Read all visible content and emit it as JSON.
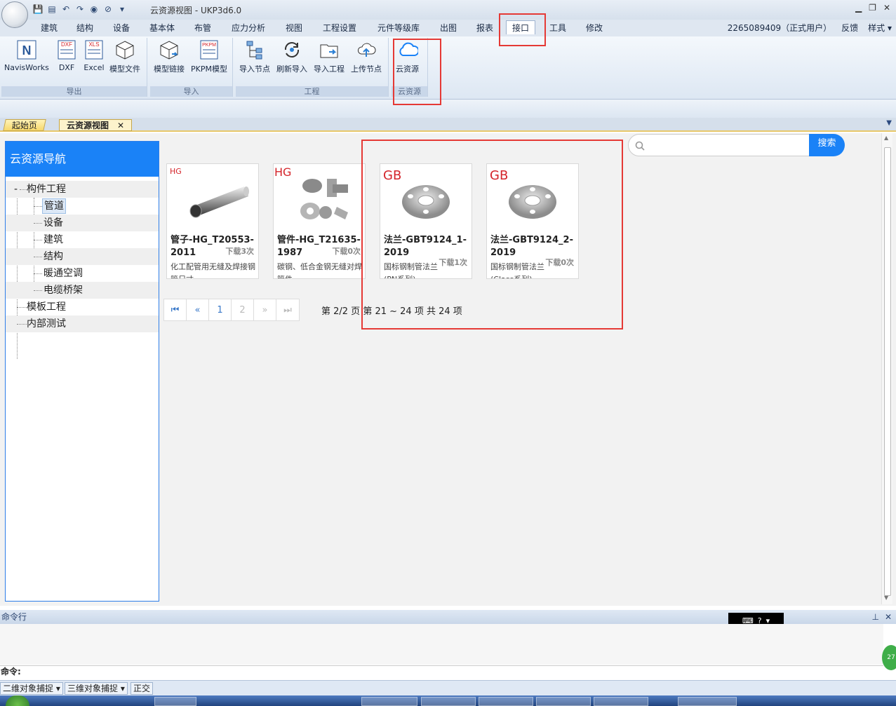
{
  "window": {
    "title": "云资源视图 - UKP3d6.0",
    "controls": [
      "▁",
      "❐",
      "✕"
    ]
  },
  "ribbon_tabs": [
    "建筑",
    "结构",
    "设备",
    "基本体",
    "布管",
    "应力分析",
    "视图",
    "工程设置",
    "元件等级库",
    "出图",
    "报表",
    "接口",
    "工具",
    "修改"
  ],
  "active_tab": "接口",
  "user": {
    "account": "2265089409（正式用户）",
    "feedback": "反馈",
    "style": "样式"
  },
  "ribbon_groups": [
    {
      "label": "导出",
      "buttons": [
        "NavisWorks",
        "DXF",
        "Excel",
        "模型文件"
      ]
    },
    {
      "label": "导入",
      "buttons": [
        "模型链接",
        "PKPM模型"
      ]
    },
    {
      "label": "工程",
      "buttons": [
        "导入节点",
        "刷新导入",
        "导入工程",
        "上传节点"
      ]
    },
    {
      "label": "云资源",
      "buttons": [
        "云资源"
      ]
    }
  ],
  "icon_texts": {
    "dxf": "DXF",
    "xls": "XLS",
    "pkpm": "PKPM",
    "navis": "N"
  },
  "doc_tabs": [
    {
      "label": "起始页"
    },
    {
      "label": "云资源视图"
    }
  ],
  "nav": {
    "title": "云资源导航",
    "tree": [
      "构件工程",
      "管道",
      "设备",
      "建筑",
      "结构",
      "暖通空调",
      "电缆桥架",
      "模板工程",
      "内部测试"
    ],
    "selected": "管道"
  },
  "search": {
    "placeholder": "",
    "button": "搜索"
  },
  "cards": [
    {
      "std": "HG",
      "name": "管子-HG_T20553-2011",
      "downloads": "下载3次",
      "desc": "化工配管用无缝及焊接钢管尺寸"
    },
    {
      "std": "HG",
      "name": "管件-HG_T21635-1987",
      "downloads": "下载0次",
      "desc": "碳钢、低合金钢无缝对焊管件"
    },
    {
      "std": "GB",
      "name": "法兰-GBT9124_1-2019",
      "downloads": "下载1次",
      "desc": "国标钢制管法兰(PN系列)"
    },
    {
      "std": "GB",
      "name": "法兰-GBT9124_2-2019",
      "downloads": "下载0次",
      "desc": "国标钢制管法兰(Class系列)"
    }
  ],
  "pager": {
    "buttons": [
      "⏮",
      "«",
      "1",
      "2",
      "»",
      "⏭"
    ],
    "info": "第 2/2 页  第 21 ~ 24 项  共 24 项"
  },
  "command": {
    "title": "命令行",
    "prompt": "命令:",
    "badge": "27"
  },
  "status": [
    "二维对象捕捉",
    "三维对象捕捉",
    "正交"
  ],
  "colors": {
    "accent": "#1a82f7",
    "highlight": "#e53935",
    "std_red": "#d4242a"
  }
}
